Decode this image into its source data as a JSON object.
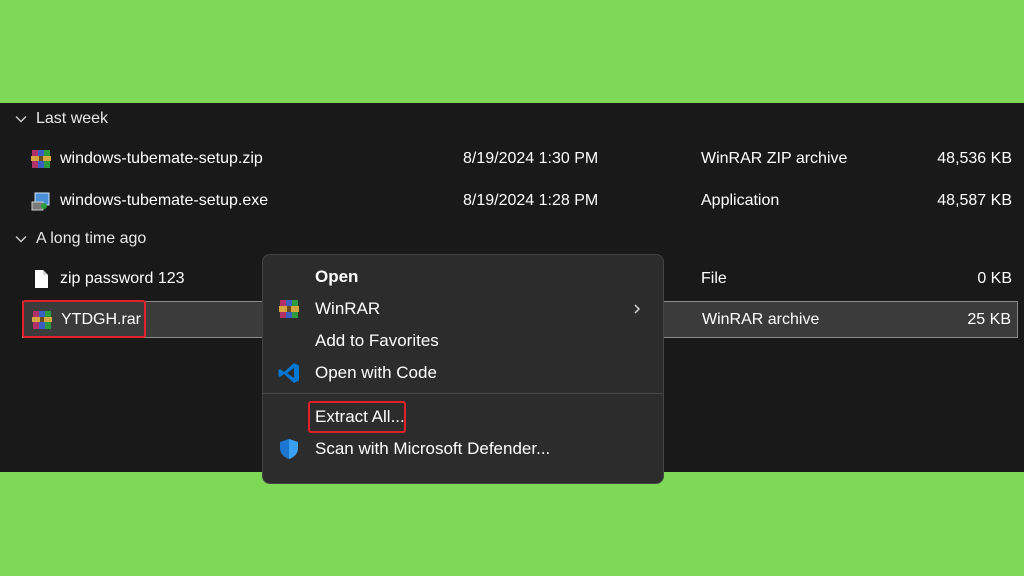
{
  "groups": {
    "last_week": "Last week",
    "long_ago": "A long time ago"
  },
  "files": [
    {
      "name": "windows-tubemate-setup.zip",
      "date": "8/19/2024 1:30 PM",
      "type": "WinRAR ZIP archive",
      "size": "48,536 KB",
      "icon": "winrar-archive-icon"
    },
    {
      "name": "windows-tubemate-setup.exe",
      "date": "8/19/2024 1:28 PM",
      "type": "Application",
      "size": "48,587 KB",
      "icon": "installer-icon"
    },
    {
      "name": "zip password 123",
      "date": "",
      "type": "File",
      "size": "0 KB",
      "icon": "blank-file-icon"
    },
    {
      "name": "YTDGH.rar",
      "date": "",
      "type": "WinRAR archive",
      "size": "25 KB",
      "icon": "winrar-archive-icon"
    }
  ],
  "context_menu": {
    "open": "Open",
    "winrar": "WinRAR",
    "add_favorites": "Add to Favorites",
    "open_with_code": "Open with Code",
    "extract_all": "Extract All...",
    "scan_defender": "Scan with Microsoft Defender..."
  },
  "colors": {
    "background_green": "#7ed957",
    "explorer_bg": "#191919",
    "menu_bg": "#2c2c2c",
    "highlight_red": "#e0202a",
    "vscode_blue": "#0078d4"
  }
}
